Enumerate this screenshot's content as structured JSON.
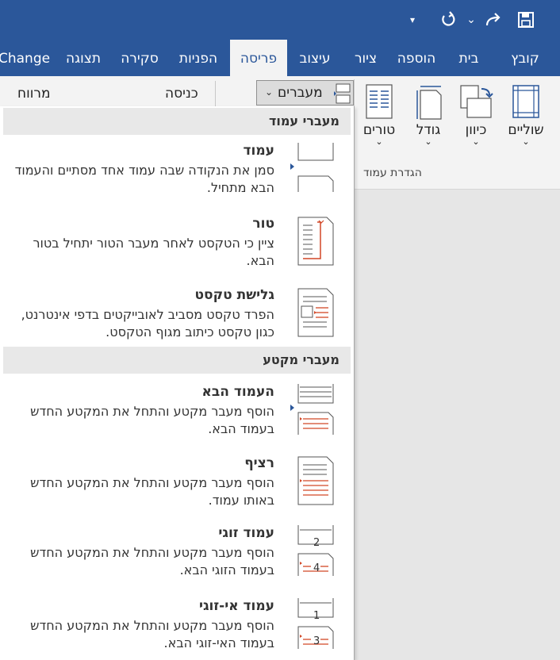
{
  "qat": {
    "customize_arrow": "▾",
    "undo_dropdown": "⌄"
  },
  "tabs": [
    {
      "key": "file",
      "label": "קובץ"
    },
    {
      "key": "home",
      "label": "בית"
    },
    {
      "key": "insert",
      "label": "הוספה"
    },
    {
      "key": "draw",
      "label": "ציור"
    },
    {
      "key": "design",
      "label": "עיצוב"
    },
    {
      "key": "layout",
      "label": "פריסה"
    },
    {
      "key": "references",
      "label": "הפניות"
    },
    {
      "key": "review",
      "label": "סקירה"
    },
    {
      "key": "view",
      "label": "תצוגה"
    },
    {
      "key": "change",
      "label": "Change"
    }
  ],
  "ribbon": {
    "margins": "שוליים",
    "orientation": "כיוון",
    "size": "גודל",
    "columns": "טורים",
    "breaks": "מעברים",
    "indent": "כניסה",
    "spacing": "מרווח",
    "group_page_setup": "הגדרת עמוד"
  },
  "menu": {
    "page_breaks_header": "מעברי עמוד",
    "section_breaks_header": "מעברי מקטע",
    "items": [
      {
        "title": "עמוד",
        "desc": "סמן את הנקודה שבה עמוד אחד מסתיים והעמוד הבא מתחיל."
      },
      {
        "title": "טור",
        "desc": "ציין כי הטקסט לאחר מעבר הטור יתחיל בטור הבא."
      },
      {
        "title": "גלישת טקסט",
        "desc": "הפרד טקסט מסביב לאובייקטים בדפי אינטרנט, כגון טקסט כיתוב מגוף הטקסט."
      },
      {
        "title": "העמוד הבא",
        "desc": "הוסף מעבר מקטע והתחל את המקטע החדש בעמוד הבא."
      },
      {
        "title": "רציף",
        "desc": "הוסף מעבר מקטע והתחל את המקטע החדש באותו עמוד."
      },
      {
        "title": "עמוד זוגי",
        "desc": "הוסף מעבר מקטע והתחל את המקטע החדש בעמוד הזוגי הבא.",
        "num_a": "2",
        "num_b": "4"
      },
      {
        "title": "עמוד אי-זוגי",
        "desc": "הוסף מעבר מקטע והתחל את המקטע החדש בעמוד האי-זוגי הבא.",
        "num_a": "1",
        "num_b": "3"
      }
    ]
  },
  "colors": {
    "accent": "#2b579a",
    "orange": "#d24726"
  }
}
